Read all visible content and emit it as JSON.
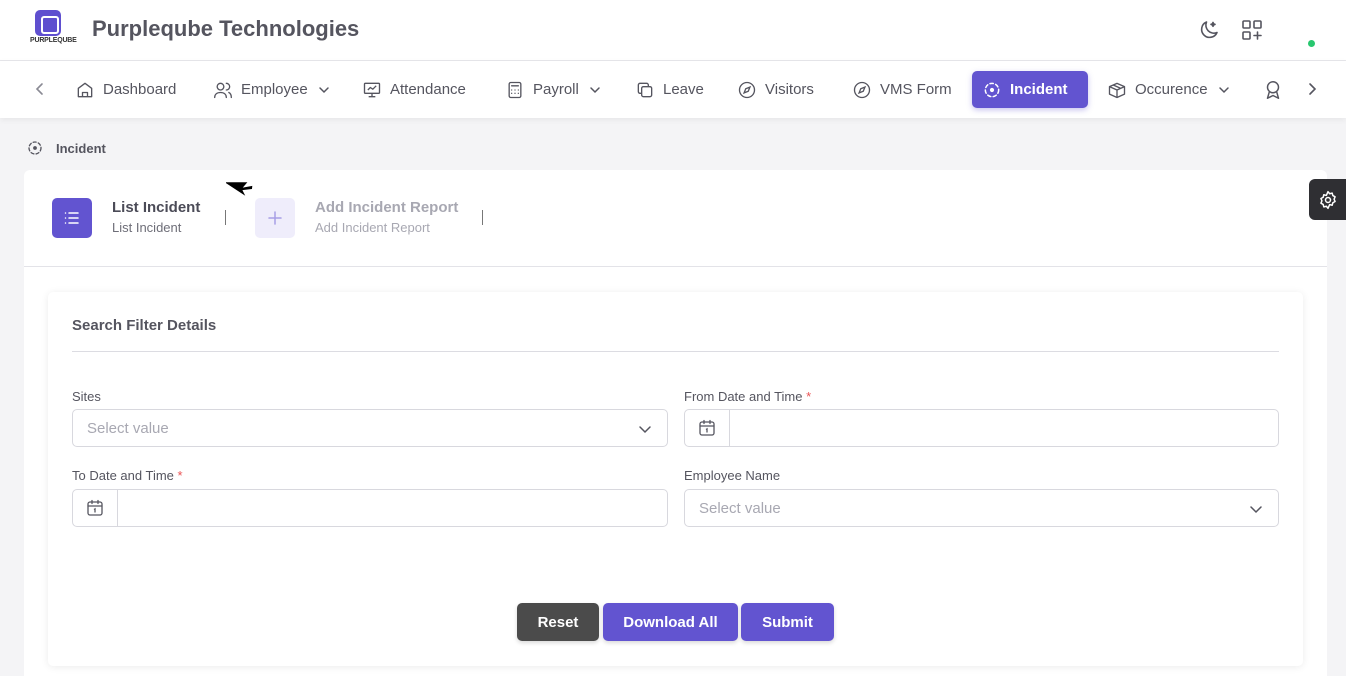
{
  "brand": {
    "logo_text": "PURPLEQUBE",
    "title": "Purpleqube Technologies"
  },
  "header_icons": [
    "moon-icon",
    "apps-grid-icon"
  ],
  "nav": {
    "items": [
      {
        "label": "Dashboard",
        "icon": "home-icon",
        "dropdown": false,
        "active": false
      },
      {
        "label": "Employee",
        "icon": "users-icon",
        "dropdown": true,
        "active": false
      },
      {
        "label": "Attendance",
        "icon": "presentation-icon",
        "dropdown": false,
        "active": false
      },
      {
        "label": "Payroll",
        "icon": "calculator-icon",
        "dropdown": true,
        "active": false
      },
      {
        "label": "Leave",
        "icon": "copy-icon",
        "dropdown": false,
        "active": false
      },
      {
        "label": "Visitors",
        "icon": "compass-icon",
        "dropdown": false,
        "active": false
      },
      {
        "label": "VMS Form",
        "icon": "compass-icon",
        "dropdown": false,
        "active": false
      },
      {
        "label": "Incident",
        "icon": "incident-icon",
        "dropdown": false,
        "active": true
      },
      {
        "label": "Occurence",
        "icon": "box-icon",
        "dropdown": true,
        "active": false
      }
    ]
  },
  "breadcrumb": {
    "label": "Incident"
  },
  "steps": [
    {
      "title": "List Incident",
      "subtitle": "List Incident",
      "active": true
    },
    {
      "title": "Add Incident Report",
      "subtitle": "Add Incident Report",
      "active": false
    }
  ],
  "filter": {
    "title": "Search Filter Details",
    "sites": {
      "label": "Sites",
      "placeholder": "Select value"
    },
    "from_date": {
      "label": "From Date and Time",
      "required_mark": "*",
      "value": ""
    },
    "to_date": {
      "label": "To Date and Time",
      "required_mark": "*",
      "value": ""
    },
    "employee": {
      "label": "Employee Name",
      "placeholder": "Select value"
    }
  },
  "buttons": {
    "reset": "Reset",
    "download_all": "Download All",
    "submit": "Submit"
  },
  "colors": {
    "primary": "#6254d0",
    "dark_button": "#4b4b4b",
    "status_online": "#28c76f"
  }
}
